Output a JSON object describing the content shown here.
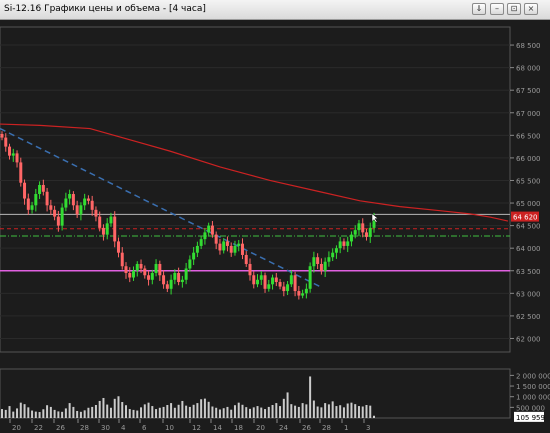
{
  "window": {
    "title": "Si-12.16 Графики цены и объема - [4 часа]",
    "buttons": [
      {
        "name": "pin-button",
        "icon": "pin-icon",
        "glyph": "⇓"
      },
      {
        "name": "minimize-button",
        "icon": "minimize-icon",
        "glyph": "–"
      },
      {
        "name": "restore-button",
        "icon": "restore-icon",
        "glyph": "⊡"
      },
      {
        "name": "close-button",
        "icon": "close-icon",
        "glyph": "×"
      }
    ]
  },
  "colors": {
    "background": "#1c1c1c",
    "bull_candle": "#33dd33",
    "bear_candle": "#ff6666",
    "moving_average": "#cc2222",
    "trend_line": "#3a6fb0",
    "support_line": "#e060e0",
    "resistance_line": "#b8b8b8",
    "last_price_tag": "#cc2222",
    "volume_bars": "#cccccc"
  },
  "chart_data": {
    "type": "candlestick",
    "price_axis": {
      "ticks": [
        "68 500",
        "68 000",
        "67 500",
        "67 000",
        "66 500",
        "66 000",
        "65 500",
        "65 000",
        "64 500",
        "64 000",
        "63 500",
        "63 000",
        "62 500",
        "62 000"
      ],
      "range": [
        61700,
        68900
      ]
    },
    "last_price": "64 620",
    "horizontal_levels": {
      "resistance": 64750,
      "red_dashed": 64430,
      "green_dashdot": 64270,
      "support": 63500
    },
    "volume_axis": {
      "ticks": [
        "2 000 000",
        "1 500 000",
        "1 000 000",
        "500 000"
      ],
      "range": [
        0,
        2300000
      ],
      "last_volume": "105 959"
    },
    "date_labels": [
      "20",
      "22",
      "26",
      "28",
      "30",
      "4",
      "6",
      "10",
      "12",
      "14",
      "18",
      "20",
      "24",
      "26",
      "28",
      "1",
      "3"
    ],
    "close": [
      66450,
      66250,
      66050,
      66100,
      65900,
      65450,
      65100,
      64850,
      64950,
      65200,
      65400,
      65250,
      64950,
      64850,
      64700,
      64500,
      64900,
      65100,
      65200,
      64950,
      64750,
      64950,
      65100,
      65050,
      64850,
      64700,
      64450,
      64300,
      64550,
      64700,
      64150,
      63900,
      63600,
      63450,
      63350,
      63500,
      63650,
      63550,
      63400,
      63300,
      63450,
      63650,
      63400,
      63200,
      63100,
      63300,
      63450,
      63250,
      63300,
      63550,
      63750,
      63900,
      64050,
      64200,
      64350,
      64500,
      64300,
      64100,
      63950,
      64150,
      64050,
      63900,
      64050,
      64100,
      63850,
      63650,
      63400,
      63200,
      63300,
      63400,
      63100,
      63200,
      63350,
      63250,
      63150,
      63050,
      63200,
      63400,
      63050,
      62950,
      63000,
      63100,
      63600,
      63800,
      63650,
      63500,
      63700,
      63800,
      63900,
      64000,
      64150,
      64050,
      64150,
      64300,
      64400,
      64550,
      64350,
      64250,
      64450,
      64700
    ],
    "volume": [
      420000,
      380000,
      560000,
      300000,
      450000,
      720000,
      650000,
      500000,
      350000,
      300000,
      280000,
      410000,
      600000,
      520000,
      380000,
      310000,
      290000,
      450000,
      700000,
      520000,
      330000,
      290000,
      360000,
      480000,
      520000,
      610000,
      800000,
      940000,
      630000,
      480000,
      900000,
      1020000,
      750000,
      600000,
      420000,
      380000,
      350000,
      500000,
      640000,
      720000,
      560000,
      420000,
      480000,
      520000,
      610000,
      700000,
      480000,
      620000,
      800000,
      580000,
      520000,
      620000,
      700000,
      880000,
      910000,
      760000,
      540000,
      480000,
      400000,
      460000,
      520000,
      390000,
      600000,
      720000,
      620000,
      510000,
      430000,
      500000,
      560000,
      490000,
      420000,
      520000,
      610000,
      700000,
      560000,
      900000,
      1200000,
      650000,
      580000,
      520000,
      700000,
      640000,
      1950000,
      820000,
      540000,
      500000,
      700000,
      640000,
      780000,
      560000,
      600000,
      500000,
      680000,
      720000,
      650000,
      560000,
      540000,
      610000,
      580000,
      105959
    ],
    "moving_average": [
      [
        0,
        66750
      ],
      [
        40,
        66720
      ],
      [
        90,
        66650
      ],
      [
        130,
        66400
      ],
      [
        170,
        66150
      ],
      [
        220,
        65800
      ],
      [
        270,
        65500
      ],
      [
        320,
        65250
      ],
      [
        360,
        65050
      ],
      [
        400,
        64920
      ],
      [
        440,
        64830
      ],
      [
        470,
        64760
      ],
      [
        490,
        64690
      ],
      [
        508,
        64600
      ]
    ],
    "trend_line": [
      [
        0,
        66650
      ],
      [
        320,
        63150
      ]
    ]
  }
}
